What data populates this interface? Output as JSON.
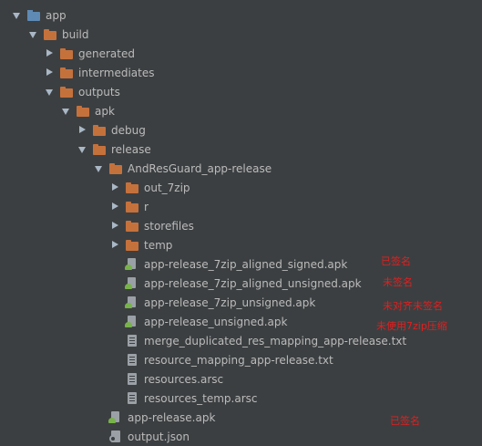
{
  "tree": [
    {
      "label": "app",
      "arrow": "open",
      "icon": "module-icon"
    },
    {
      "label": "build",
      "arrow": "open",
      "icon": "folder-icon"
    },
    {
      "label": "generated",
      "arrow": "closed",
      "icon": "folder-icon"
    },
    {
      "label": "intermediates",
      "arrow": "closed",
      "icon": "folder-icon"
    },
    {
      "label": "outputs",
      "arrow": "open",
      "icon": "folder-icon"
    },
    {
      "label": "apk",
      "arrow": "open",
      "icon": "folder-icon"
    },
    {
      "label": "debug",
      "arrow": "closed",
      "icon": "folder-icon"
    },
    {
      "label": "release",
      "arrow": "open",
      "icon": "folder-icon"
    },
    {
      "label": "AndResGuard_app-release",
      "arrow": "open",
      "icon": "folder-icon"
    },
    {
      "label": "out_7zip",
      "arrow": "closed",
      "icon": "folder-icon"
    },
    {
      "label": "r",
      "arrow": "closed",
      "icon": "folder-icon"
    },
    {
      "label": "storefiles",
      "arrow": "closed",
      "icon": "folder-icon"
    },
    {
      "label": "temp",
      "arrow": "closed",
      "icon": "folder-icon"
    },
    {
      "label": "app-release_7zip_aligned_signed.apk",
      "arrow": "none",
      "icon": "apk-file-icon"
    },
    {
      "label": "app-release_7zip_aligned_unsigned.apk",
      "arrow": "none",
      "icon": "apk-file-icon"
    },
    {
      "label": "app-release_7zip_unsigned.apk",
      "arrow": "none",
      "icon": "apk-file-icon"
    },
    {
      "label": "app-release_unsigned.apk",
      "arrow": "none",
      "icon": "apk-file-icon"
    },
    {
      "label": "merge_duplicated_res_mapping_app-release.txt",
      "arrow": "none",
      "icon": "text-file-icon"
    },
    {
      "label": "resource_mapping_app-release.txt",
      "arrow": "none",
      "icon": "text-file-icon"
    },
    {
      "label": "resources.arsc",
      "arrow": "none",
      "icon": "text-file-icon"
    },
    {
      "label": "resources_temp.arsc",
      "arrow": "none",
      "icon": "text-file-icon"
    },
    {
      "label": "app-release.apk",
      "arrow": "none",
      "icon": "apk-file-icon"
    },
    {
      "label": "output.json",
      "arrow": "none",
      "icon": "json-file-icon"
    }
  ],
  "annotations": [
    {
      "text": "已签名"
    },
    {
      "text": "未签名"
    },
    {
      "text": "未对齐未签名"
    },
    {
      "text": "未使用7zip压缩"
    },
    {
      "text": "已签名"
    }
  ],
  "colors": {
    "background": "#3c3f41",
    "text": "#bbbbbb",
    "folder": "#c5713c",
    "module": "#5e8ab4",
    "annotation": "#e02020"
  }
}
